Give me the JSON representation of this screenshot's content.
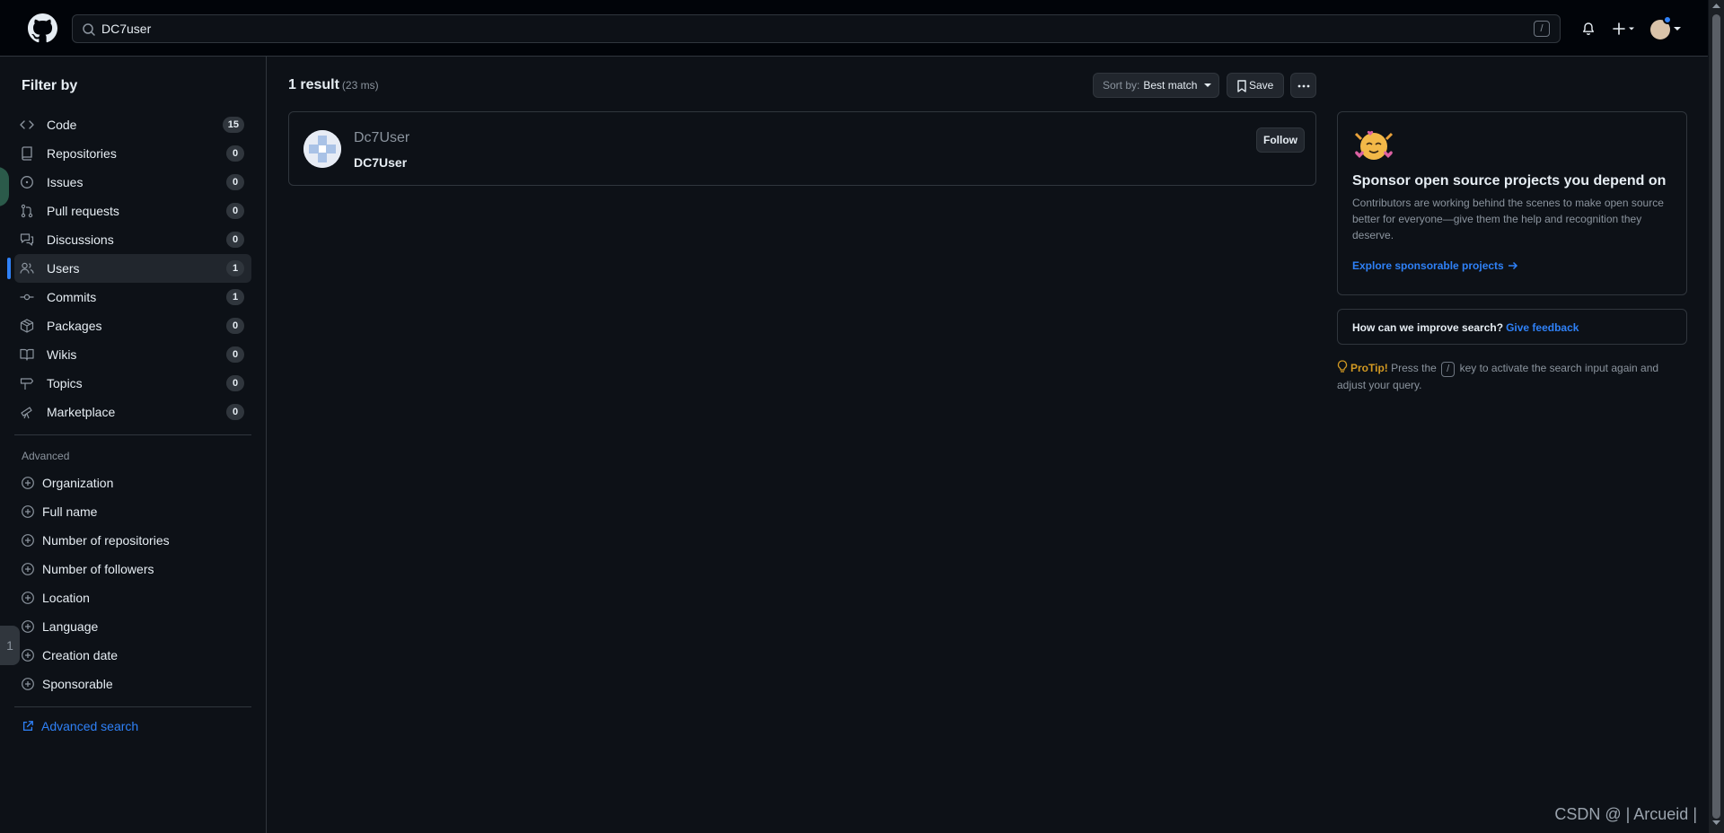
{
  "header": {
    "search_value": "DC7user",
    "search_shortcut": "/"
  },
  "sidebar": {
    "title": "Filter by",
    "items": [
      {
        "label": "Code",
        "count": "15",
        "icon": "code-icon"
      },
      {
        "label": "Repositories",
        "count": "0",
        "icon": "repo-icon"
      },
      {
        "label": "Issues",
        "count": "0",
        "icon": "issue-icon"
      },
      {
        "label": "Pull requests",
        "count": "0",
        "icon": "pull-request-icon"
      },
      {
        "label": "Discussions",
        "count": "0",
        "icon": "discussion-icon"
      },
      {
        "label": "Users",
        "count": "1",
        "icon": "people-icon",
        "active": true
      },
      {
        "label": "Commits",
        "count": "1",
        "icon": "commit-icon"
      },
      {
        "label": "Packages",
        "count": "0",
        "icon": "package-icon"
      },
      {
        "label": "Wikis",
        "count": "0",
        "icon": "book-icon"
      },
      {
        "label": "Topics",
        "count": "0",
        "icon": "tag-icon"
      },
      {
        "label": "Marketplace",
        "count": "0",
        "icon": "telescope-icon"
      }
    ],
    "advanced_title": "Advanced",
    "advanced": [
      "Organization",
      "Full name",
      "Number of repositories",
      "Number of followers",
      "Location",
      "Language",
      "Creation date",
      "Sponsorable"
    ],
    "advanced_search_label": "Advanced search"
  },
  "main": {
    "results_count": "1 result",
    "results_time": "(23 ms)",
    "sort_prefix": "Sort by:",
    "sort_value": "Best match",
    "save_label": "Save",
    "result": {
      "login": "Dc7User",
      "name": "DC7User",
      "follow_label": "Follow"
    }
  },
  "right": {
    "sponsor_title": "Sponsor open source projects you depend on",
    "sponsor_body": "Contributors are working behind the scenes to make open source better for everyone—give them the help and recognition they deserve.",
    "sponsor_link": "Explore sponsorable projects",
    "feedback_question": "How can we improve search?",
    "feedback_link": "Give feedback",
    "protip_label": "ProTip!",
    "protip_before": "Press the",
    "protip_key": "/",
    "protip_after": "key to activate the search input again and adjust your query."
  },
  "overlay": {
    "watermark": "CSDN @ | Arcueid |",
    "left_tab": "1"
  },
  "colors": {
    "accent": "#2f81f7",
    "background": "#0d1117",
    "border": "#30363d",
    "protip": "#d29922"
  }
}
